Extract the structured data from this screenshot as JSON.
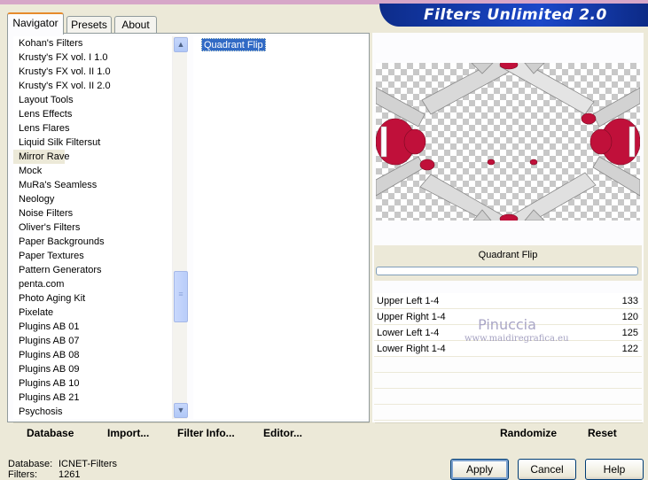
{
  "banner": {
    "title": "Filters Unlimited 2.0"
  },
  "tabs": [
    {
      "label": "Navigator",
      "active": true
    },
    {
      "label": "Presets",
      "active": false
    },
    {
      "label": "About",
      "active": false
    }
  ],
  "categories": {
    "items": [
      "Kohan's Filters",
      "Krusty's FX vol. I 1.0",
      "Krusty's FX vol. II 1.0",
      "Krusty's FX vol. II 2.0",
      "Layout Tools",
      "Lens Effects",
      "Lens Flares",
      "Liquid Silk Filtersut",
      "Mirror Rave",
      "Mock",
      "MuRa's Seamless",
      "Neology",
      "Noise Filters",
      "Oliver's Filters",
      "Paper Backgrounds",
      "Paper Textures",
      "Pattern Generators",
      "penta.com",
      "Photo Aging Kit",
      "Pixelate",
      "Plugins AB 01",
      "Plugins AB 07",
      "Plugins AB 08",
      "Plugins AB 09",
      "Plugins AB 10",
      "Plugins AB 21",
      "Psychosis"
    ],
    "selected": "Mirror Rave",
    "scroll_up_icon": "arrow-up-icon",
    "scroll_down_icon": "arrow-down-icon"
  },
  "filters": {
    "items": [
      "Quadrant Flip"
    ],
    "selected": "Quadrant Flip"
  },
  "preview": {
    "filter_name": "Quadrant Flip",
    "progress_fraction": 0
  },
  "params": [
    {
      "label": "Upper Left 1-4",
      "value": "133"
    },
    {
      "label": "Upper Right 1-4",
      "value": "120"
    },
    {
      "label": "Lower Left 1-4",
      "value": "125"
    },
    {
      "label": "Lower Right 1-4",
      "value": "122"
    }
  ],
  "watermark": {
    "name": "Pinuccia",
    "site": "www.maidiregrafica.eu"
  },
  "toolbar": {
    "database": "Database",
    "import": "Import...",
    "filter_info": "Filter Info...",
    "editor": "Editor...",
    "randomize": "Randomize",
    "reset": "Reset"
  },
  "status": {
    "database_key": "Database:",
    "database_value": "ICNET-Filters",
    "filters_key": "Filters:",
    "filters_value": "1261"
  },
  "buttons": {
    "apply": "Apply",
    "cancel": "Cancel",
    "help": "Help"
  },
  "colors": {
    "accent_red": "#c0103a",
    "selection_blue": "#316ac5",
    "banner_blue": "#1b48c9"
  }
}
